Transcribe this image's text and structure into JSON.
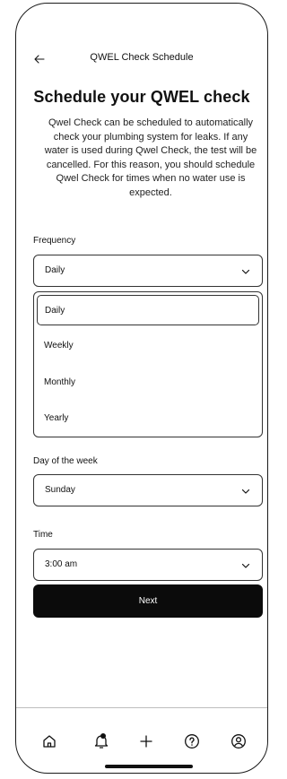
{
  "header": {
    "title": "QWEL Check Schedule",
    "back_icon": "arrow-left-icon"
  },
  "main": {
    "title": "Schedule your QWEL check",
    "description": "Qwel Check can be scheduled to automatically check your plumbing system for leaks. If any water is used during Qwel Check, the test will be cancelled. For this reason, you should schedule Qwel Check for times when no water use is expected."
  },
  "frequency": {
    "label": "Frequency",
    "value": "Daily",
    "options": [
      "Daily",
      "Weekly",
      "Monthly",
      "Yearly"
    ],
    "selected_option": "Daily"
  },
  "day_of_week": {
    "label": "Day of the week",
    "value": "Sunday"
  },
  "time": {
    "label": "Time",
    "value": "3:00 am"
  },
  "next_button": {
    "label": "Next"
  },
  "tabbar": {
    "items": [
      "home-icon",
      "bell-notification-icon",
      "plus-icon",
      "help-circle-icon",
      "profile-icon"
    ]
  }
}
